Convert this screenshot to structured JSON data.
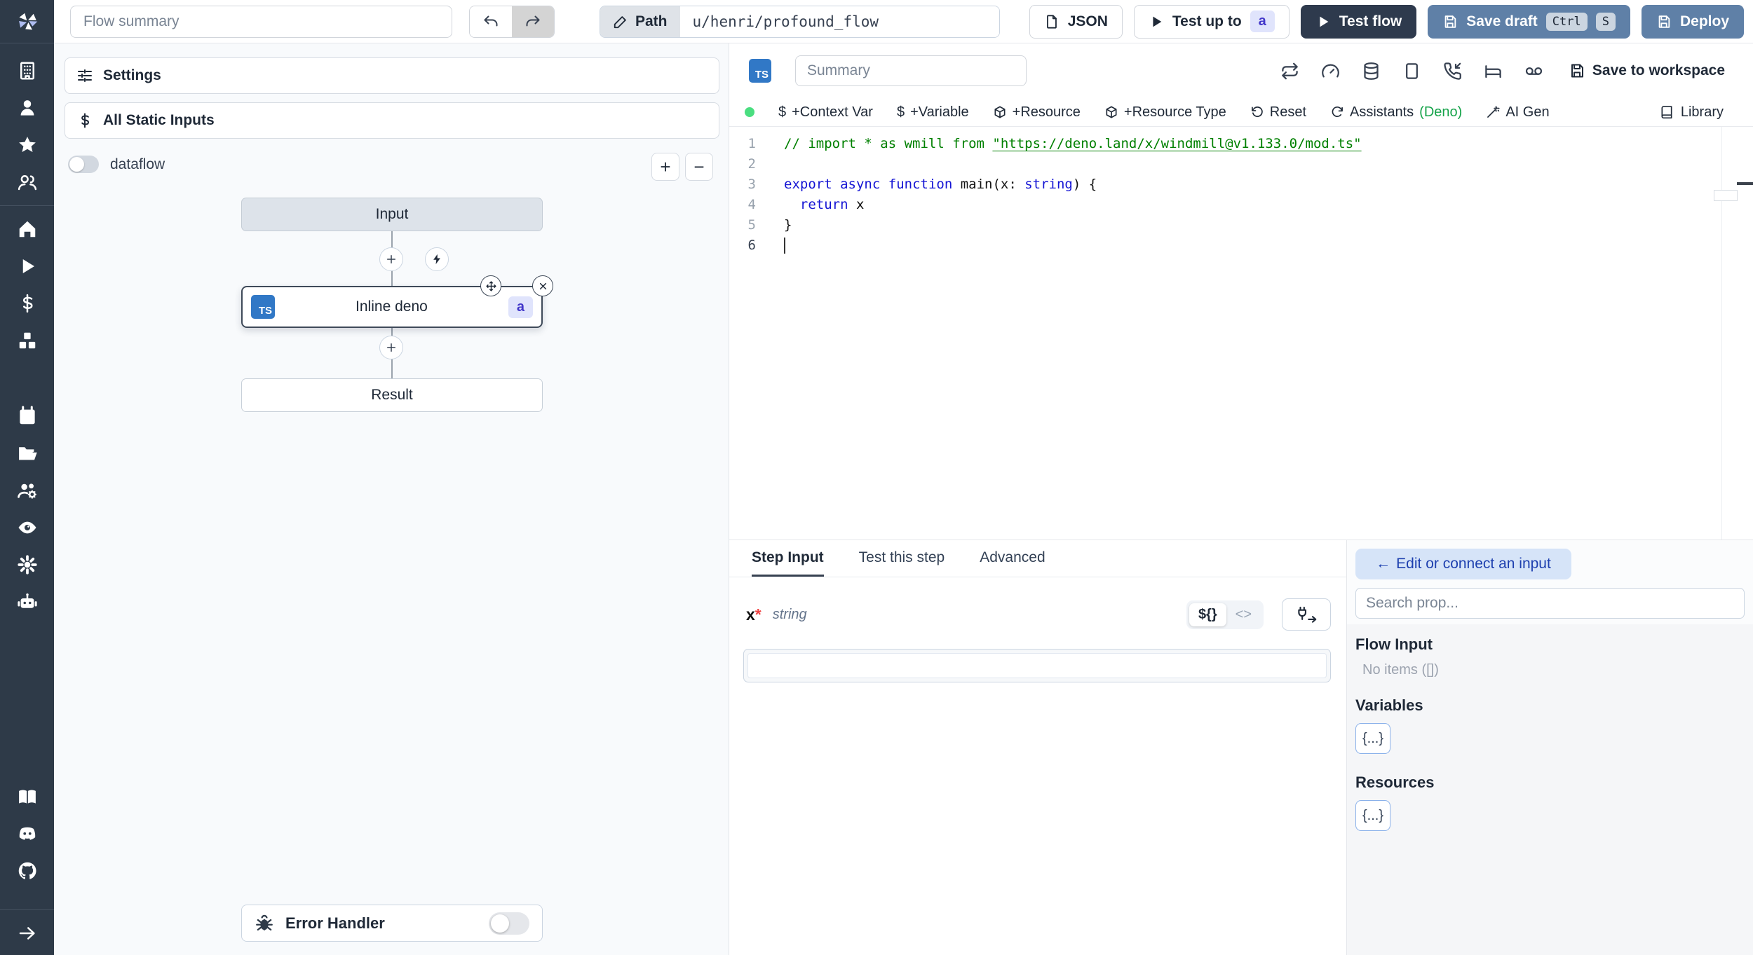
{
  "topbar": {
    "flow_summary_placeholder": "Flow summary",
    "path_label": "Path",
    "path_value": "u/henri/profound_flow",
    "json_label": "JSON",
    "test_up_to_label": "Test up to",
    "test_up_to_badge": "a",
    "test_flow_label": "Test flow",
    "save_draft_label": "Save draft",
    "save_draft_kbd": [
      "Ctrl",
      "S"
    ],
    "deploy_label": "Deploy"
  },
  "icons": {
    "dollar": "$",
    "arrow_left": "←",
    "arrow_right": "→"
  },
  "colors": {
    "sidebar_bg": "#2e3a48",
    "primary_button_blue": "#5f80a7",
    "dark_button": "#2e3a4d",
    "step_id_badge_bg": "#e0e4fc",
    "step_id_badge_text": "#4338ca",
    "ts_badge_bg": "#3178c6",
    "green_dot": "#4ade80",
    "deno_green": "#16a34a",
    "comment_green": "#008000",
    "keyword_blue": "#1414d4"
  },
  "flow_panel": {
    "settings_label": "Settings",
    "static_inputs_label": "All Static Inputs",
    "dataflow_label": "dataflow",
    "zoom_in_label": "+",
    "zoom_out_label": "−",
    "nodes": {
      "input_label": "Input",
      "step_label": "Inline deno",
      "step_lang_badge": "TS",
      "step_id_badge": "a",
      "result_label": "Result"
    },
    "error_handler_label": "Error Handler"
  },
  "editor_panel": {
    "lang_badge": "TS",
    "summary_placeholder": "Summary",
    "save_to_workspace_label": "Save to workspace",
    "toolbar": {
      "context_var_label": "+Context Var",
      "variable_label": "+Variable",
      "resource_label": "+Resource",
      "resource_type_label": "+Resource Type",
      "reset_label": "Reset",
      "assistants_label": "Assistants",
      "assistants_lang": "(Deno)",
      "ai_gen_label": "AI Gen",
      "library_label": "Library"
    },
    "code": {
      "lines": [
        {
          "num": "1",
          "tokens": [
            {
              "t": "// import * as wmill from ",
              "c": "cm"
            },
            {
              "t": "\"https://deno.land/x/windmill@v1.133.0/mod.ts\"",
              "c": "cm-link"
            }
          ]
        },
        {
          "num": "2",
          "tokens": []
        },
        {
          "num": "3",
          "tokens": [
            {
              "t": "export",
              "c": "kw"
            },
            {
              "t": " ",
              "c": "pl"
            },
            {
              "t": "async",
              "c": "kw"
            },
            {
              "t": " ",
              "c": "pl"
            },
            {
              "t": "function",
              "c": "kw"
            },
            {
              "t": " main(x: ",
              "c": "pl"
            },
            {
              "t": "string",
              "c": "kw"
            },
            {
              "t": ") {",
              "c": "pl"
            }
          ]
        },
        {
          "num": "4",
          "tokens": [
            {
              "t": "  ",
              "c": "pl"
            },
            {
              "t": "return",
              "c": "kw"
            },
            {
              "t": " x",
              "c": "pl"
            }
          ]
        },
        {
          "num": "5",
          "tokens": [
            {
              "t": "}",
              "c": "pl"
            }
          ]
        },
        {
          "num": "6",
          "tokens": [],
          "cursor": true,
          "active": true
        }
      ]
    }
  },
  "step_panel": {
    "tabs": [
      {
        "label": "Step Input",
        "active": true
      },
      {
        "label": "Test this step",
        "active": false
      },
      {
        "label": "Advanced",
        "active": false
      }
    ],
    "arg_name": "x",
    "arg_required_mark": "*",
    "arg_type": "string",
    "expr_toggle_label": "${}",
    "code_toggle_label": "<>",
    "arg_value": ""
  },
  "prop_panel": {
    "edit_connect_label": "Edit or connect an input",
    "search_placeholder": "Search prop...",
    "flow_input_title": "Flow Input",
    "flow_input_empty": "No items ([])",
    "variables_title": "Variables",
    "variables_button": "{...}",
    "resources_title": "Resources",
    "resources_button": "{...}"
  },
  "sidebar_icon_names": [
    "windmill-logo",
    "building",
    "user",
    "star",
    "users",
    "home",
    "play",
    "dollar",
    "boxes",
    "calendar",
    "folder",
    "users-gear",
    "eye",
    "gear",
    "robot",
    "book",
    "discord",
    "github",
    "arrow-right"
  ]
}
